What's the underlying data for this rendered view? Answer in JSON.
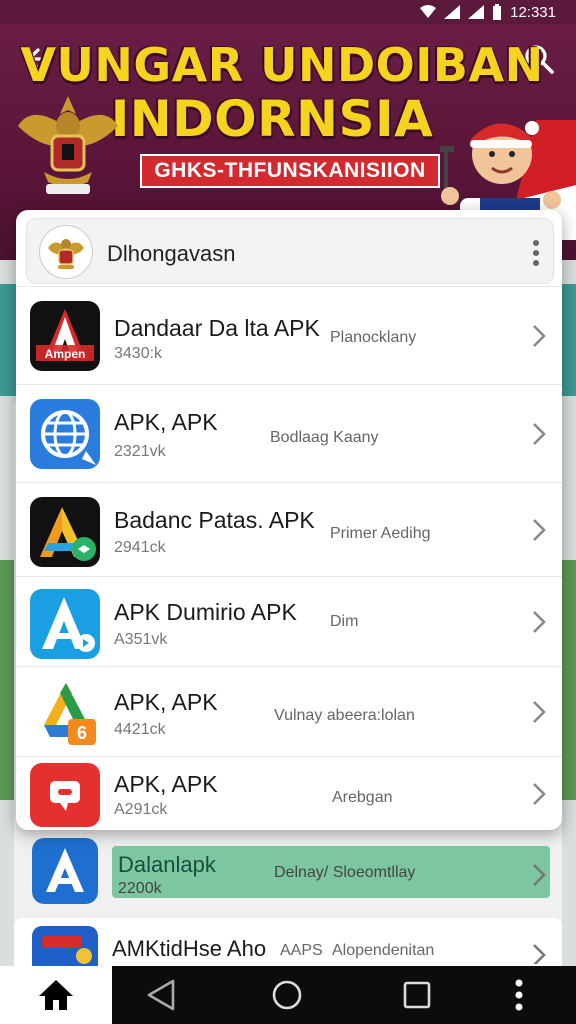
{
  "status_bar": {
    "time": "12:331"
  },
  "header": {
    "title_line1": "VUNGAR UNDOIBAN",
    "title_line2": "INDORNSIA",
    "subtitle": "GHKS-THFUNSKANISIION",
    "back_icon": "arrow-left-icon",
    "search_icon": "search-icon"
  },
  "card": {
    "title": "Dlhongavasn",
    "emblem_icon": "garuda-emblem-icon",
    "more_icon": "more-vert-icon",
    "apps": [
      {
        "name": "Dandaar Da lta APK",
        "size": "3430:k",
        "developer": "Planocklany",
        "icon": "red-a-app-icon",
        "icon_label": "Ampen"
      },
      {
        "name": "APK, APK",
        "size": "2321vk",
        "developer": "Bodlaag Kaany",
        "icon": "globe-app-icon"
      },
      {
        "name": "Badanc Patas. APK",
        "size": "2941ck",
        "developer": "Primer Aedihg",
        "icon": "orange-a-app-icon"
      },
      {
        "name": "APK Dumirio APK",
        "size": "A351vk",
        "developer": "Dim",
        "icon": "blue-a-app-icon"
      },
      {
        "name": "APK, APK",
        "size": "4421ck",
        "developer": "Vulnay abeera:lolan",
        "icon": "drive-style-app-icon"
      },
      {
        "name": "APK, APK",
        "size": "A291ck",
        "developer": "Arebgan",
        "icon": "red-bubble-app-icon"
      }
    ]
  },
  "background_list": [
    {
      "name": "Dalanlapk",
      "size": "2200k",
      "developer": "Delnay/ Sloeomtllay",
      "icon": "blue-a-app-icon"
    },
    {
      "name": "AMKtidHse Aho",
      "tag": "AAPS",
      "developer": "Alopendenitan",
      "icon": "tools-app-icon"
    }
  ],
  "nav_bar": {
    "home_icon": "home-icon",
    "back_icon": "nav-back-icon",
    "home_circle_icon": "circle-home-icon",
    "recents_icon": "recents-square-icon",
    "menu_icon": "more-vert-icon"
  },
  "colors": {
    "header_bg": "#5a1538",
    "title_yellow": "#f5d31f",
    "banner_red": "#d32a2f",
    "teal_band": "#3b9a92"
  }
}
